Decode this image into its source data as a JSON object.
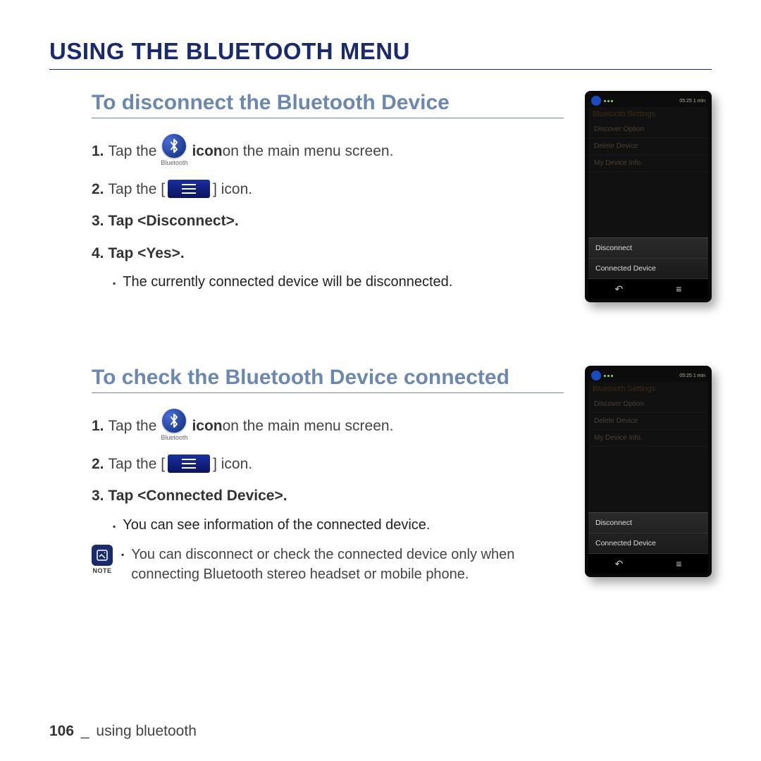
{
  "page_title": "USING THE BLUETOOTH MENU",
  "section1": {
    "title": "To disconnect the Bluetooth Device",
    "step1_a": "Tap the",
    "step1_b": "icon",
    "step1_c": " on the main menu screen.",
    "bt_label": "Bluetooth",
    "step2_a": "Tap the [",
    "step2_b": "] icon.",
    "step3": "Tap <Disconnect>.",
    "step4": "Tap <Yes>.",
    "sub": "The currently connected device will be disconnected."
  },
  "section2": {
    "title": "To check the Bluetooth Device connected",
    "step1_a": "Tap the",
    "step1_b": "icon",
    "step1_c": " on the main menu screen.",
    "bt_label": "Bluetooth",
    "step2_a": "Tap the [",
    "step2_b": "] icon.",
    "step3": "Tap <Connected Device>.",
    "sub": "You can see information of the connected device.",
    "note_label": "NOTE",
    "note_text": "You can disconnect or check the connected device only when connecting Bluetooth stereo headset or mobile phone."
  },
  "phone": {
    "status_time": "05:25 1 min",
    "screen_title": "Bluetooth Settings",
    "items": {
      "opt1": "Discover Option",
      "opt2": "Delete Device",
      "opt3": "My Device Info."
    },
    "popup": {
      "p1": "Disconnect",
      "p2": "Connected Device"
    },
    "nav_back": "↶",
    "nav_menu": "≡"
  },
  "footer": {
    "page": "106",
    "sep": "_",
    "label": " using bluetooth"
  }
}
